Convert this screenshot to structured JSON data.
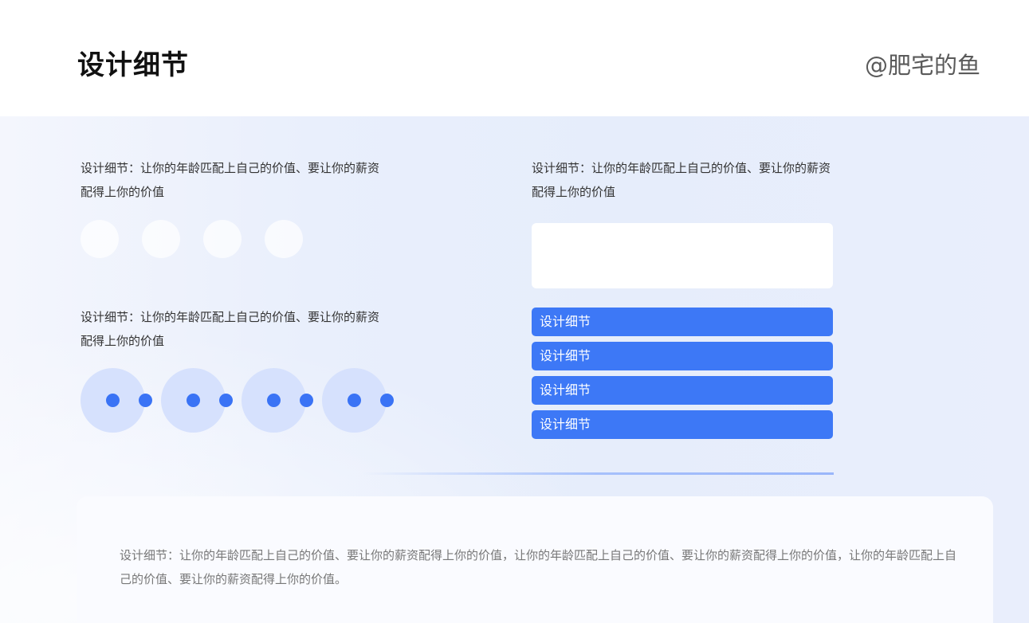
{
  "header": {
    "title": "设计细节",
    "author": "@肥宅的鱼"
  },
  "sections": {
    "top_left_text": "设计细节：让你的年龄匹配上自己的价值、要让你的薪资配得上你的价值",
    "top_right_text": "设计细节：让你的年龄匹配上自己的价值、要让你的薪资配得上你的价值",
    "mid_left_text": "设计细节：让你的年龄匹配上自己的价值、要让你的薪资配得上你的价值"
  },
  "tags": [
    "设计细节",
    "设计细节",
    "设计细节",
    "设计细节"
  ],
  "card": {
    "text": "设计细节：让你的年龄匹配上自己的价值、要让你的薪资配得上你的价值，让你的年龄匹配上自己的价值、要让你的薪资配得上你的价值，让你的年龄匹配上自己的价值、要让你的薪资配得上你的价值。"
  },
  "colors": {
    "accent": "#3d78f6",
    "ring": "#d6e1fd"
  }
}
